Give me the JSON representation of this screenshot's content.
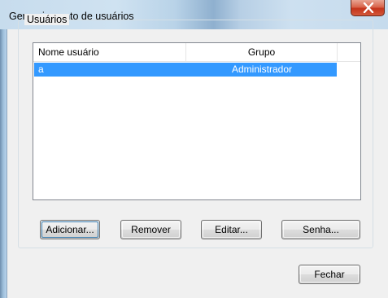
{
  "window": {
    "title": "Gerenciamento de usuários",
    "close_icon": "close-icon"
  },
  "users_group": {
    "label": "Usuários",
    "columns": [
      "Nome usuário",
      "Grupo"
    ],
    "rows": [
      {
        "name": "a",
        "group": "Administrador",
        "selected": true
      }
    ]
  },
  "buttons": {
    "add": "Adicionar...",
    "remove": "Remover",
    "edit": "Editar...",
    "password": "Senha...",
    "close": "Fechar"
  },
  "colors": {
    "selection": "#3399ff",
    "close_button": "#c4341b"
  }
}
